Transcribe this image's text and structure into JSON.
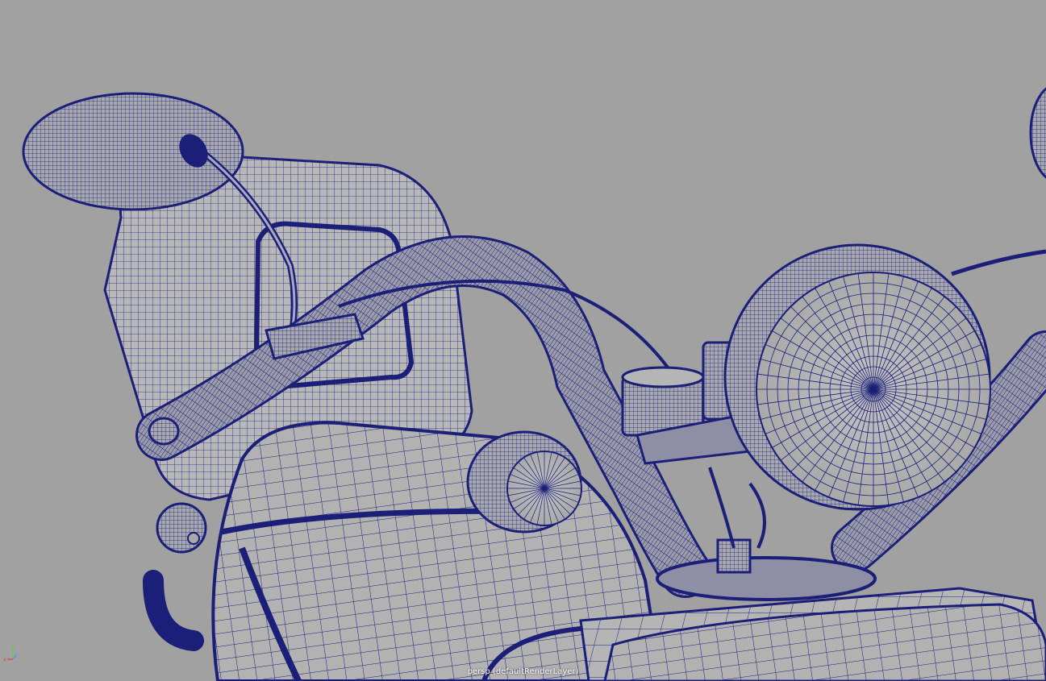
{
  "viewport": {
    "camera_label": "persp (defaultRenderLayer)",
    "background_color": "#a1a1a1",
    "wire_color": "#1b1f78",
    "mesh_color": "#b7b7b7",
    "axis": {
      "x": "x",
      "y": "y",
      "z": "z",
      "x_color": "#e23b3b",
      "y_color": "#4fd14f",
      "z_color": "#4a90ff"
    }
  }
}
